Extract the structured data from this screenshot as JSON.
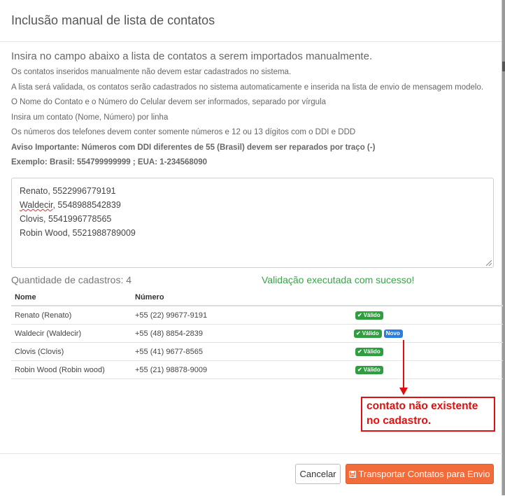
{
  "modal": {
    "title": "Inclusão manual de lista de contatos"
  },
  "instructions": {
    "lead": "Insira no campo abaixo a lista de contatos a serem importados manualmente.",
    "lines": [
      "Os contatos inseridos manualmente não devem estar cadastrados no sistema.",
      "A lista será validada, os contatos serão cadastrados no sistema automaticamente e inserida na lista de envio de mensagem modelo.",
      "O Nome do Contato e o Número do Celular devem ser informados, separado por vírgula",
      "Insira um contato (Nome, Número) por linha",
      "Os números dos telefones devem conter somente números e 12 ou 13 dígitos com o DDI e DDD"
    ],
    "warning": "Aviso Importante: Números com DDI diferentes de 55 (Brasil) devem ser reparados por traço (-)",
    "example": "Exemplo: Brasil: 554799999999 ; EUA: 1-234568090"
  },
  "input": {
    "lines": [
      {
        "name": "Renato",
        "rest": ", 5522996779191"
      },
      {
        "name": "Waldecir",
        "rest": ", 5548988542839"
      },
      {
        "name": "Clovis",
        "rest": ", 5541996778565"
      },
      {
        "name": "Robin Wood",
        "rest": ", 5521988789009"
      }
    ]
  },
  "summary": {
    "quantity": "Quantidade de cadastros: 4",
    "status": "Validação executada com sucesso!"
  },
  "table": {
    "headers": {
      "name": "Nome",
      "number": "Número"
    },
    "rows": [
      {
        "name": "Renato (Renato)",
        "number": "+55 (22) 99677-9191",
        "valid": "Válido",
        "new": ""
      },
      {
        "name": "Waldecir (Waldecir)",
        "number": "+55 (48) 8854-2839",
        "valid": "Válido",
        "new": "Novo"
      },
      {
        "name": "Clovis (Clovis)",
        "number": "+55 (41) 9677-8565",
        "valid": "Válido",
        "new": ""
      },
      {
        "name": "Robin Wood (Robin wood)",
        "number": "+55 (21) 98878-9009",
        "valid": "Válido",
        "new": ""
      }
    ]
  },
  "annotation": {
    "line1": "contato não existente",
    "line2": "no cadastro.",
    "color": "#e01010"
  },
  "footer": {
    "cancel_label": "Cancelar",
    "submit_label": "Transportar Contatos para Envio"
  },
  "colors": {
    "primary": "#f26b3a",
    "success": "#3aa34a",
    "badge_valid": "#2e9e3e",
    "badge_new": "#2b7de0"
  },
  "icons": {
    "check": "check-icon",
    "save": "save-icon",
    "arrow": "arrow-down-icon"
  }
}
